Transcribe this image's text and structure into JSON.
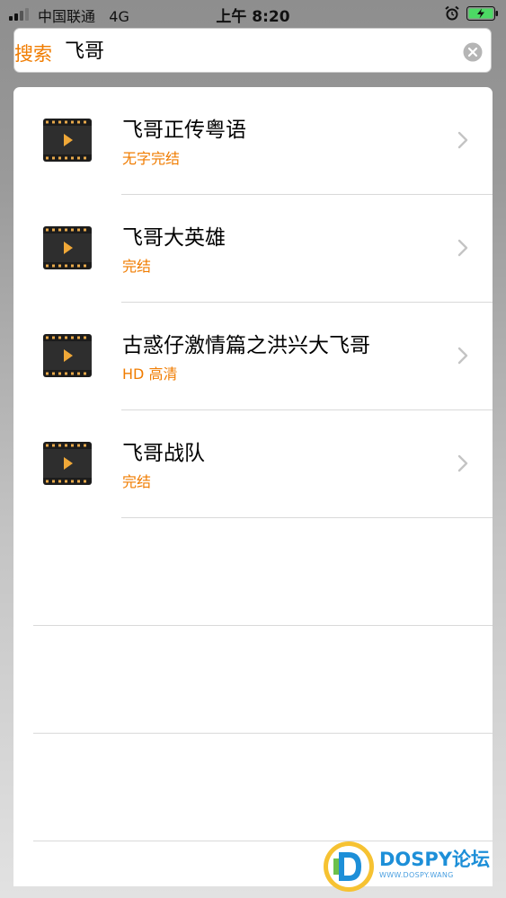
{
  "status_bar": {
    "carrier": "中国联通",
    "network": "4G",
    "time": "上午 8:20"
  },
  "search": {
    "label": "搜索",
    "value": "飞哥"
  },
  "results": [
    {
      "title": "飞哥正传粤语",
      "subtitle": "无字完结"
    },
    {
      "title": "飞哥大英雄",
      "subtitle": "完结"
    },
    {
      "title": "古惑仔激情篇之洪兴大飞哥",
      "subtitle": "HD 高清"
    },
    {
      "title": "飞哥战队",
      "subtitle": "完结"
    }
  ],
  "watermark": {
    "brand": "DOSPY论坛",
    "sub": "WWW.DOSPY.WANG"
  },
  "colors": {
    "accent": "#f07c00",
    "separator": "#d9d9d9",
    "battery": "#4cd964"
  },
  "icons": [
    "signal-icon",
    "alarm-icon",
    "battery-icon",
    "clear-icon",
    "film-icon",
    "chevron-right-icon",
    "dospy-logo-icon"
  ]
}
